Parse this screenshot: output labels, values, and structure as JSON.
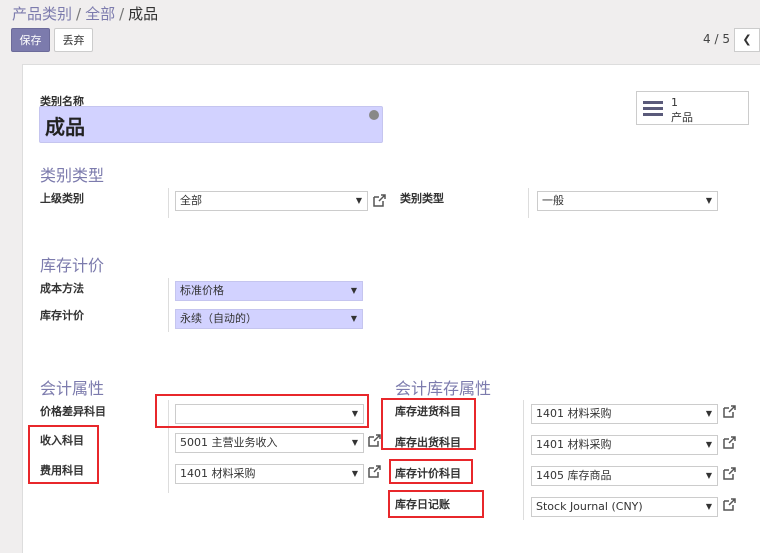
{
  "breadcrumb": {
    "root": "产品类别",
    "middle": "全部",
    "current": "成品"
  },
  "toolbar": {
    "save_label": "保存",
    "discard_label": "丢弃"
  },
  "pager": {
    "text": "4 / 5"
  },
  "form": {
    "name_label": "类别名称",
    "name_value": "成品",
    "stat_button": {
      "count": "1",
      "label": "产品"
    },
    "sections": {
      "category_type": "类别类型",
      "inventory_valuation": "库存计价",
      "account_properties": "会计属性",
      "stock_account_properties": "会计库存属性"
    },
    "fields": {
      "parent_category": {
        "label": "上级类别",
        "value": "全部"
      },
      "category_type": {
        "label": "类别类型",
        "value": "一般"
      },
      "costing_method": {
        "label": "成本方法",
        "value": "标准价格"
      },
      "inventory_valuation": {
        "label": "库存计价",
        "value": "永续（自动的）"
      },
      "price_difference_account": {
        "label": "价格差异科目",
        "value": ""
      },
      "income_account": {
        "label": "收入科目",
        "value": "5001 主营业务收入"
      },
      "expense_account": {
        "label": "费用科目",
        "value": "1401 材料采购"
      },
      "stock_input_account": {
        "label": "库存进货科目",
        "value": "1401 材料采购"
      },
      "stock_output_account": {
        "label": "库存出货科目",
        "value": "1401 材料采购"
      },
      "stock_valuation_account": {
        "label": "库存计价科目",
        "value": "1405 库存商品"
      },
      "stock_journal": {
        "label": "库存日记账",
        "value": "Stock Journal (CNY)"
      }
    }
  },
  "colors": {
    "accent": "#7c7bad",
    "highlight": "#e8272b",
    "required_bg": "#d2d2ff"
  }
}
